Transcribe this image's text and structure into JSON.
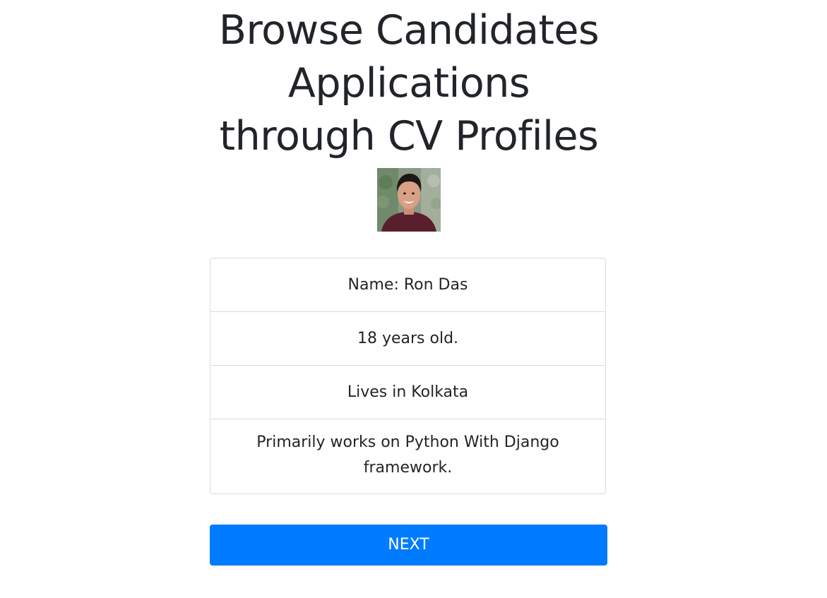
{
  "page": {
    "title_lines": [
      "Browse Candidates",
      "Applications",
      "through CV Profiles"
    ]
  },
  "candidate": {
    "avatar_icon": "candidate-photo",
    "name": "Name: Ron Das",
    "age": "18 years old.",
    "location": "Lives in Kolkata",
    "skills": "Primarily works on Python With Django framework."
  },
  "actions": {
    "next_label": "NEXT"
  },
  "colors": {
    "primary": "#007bff",
    "text": "#212529",
    "border": "#dcdcdc"
  }
}
